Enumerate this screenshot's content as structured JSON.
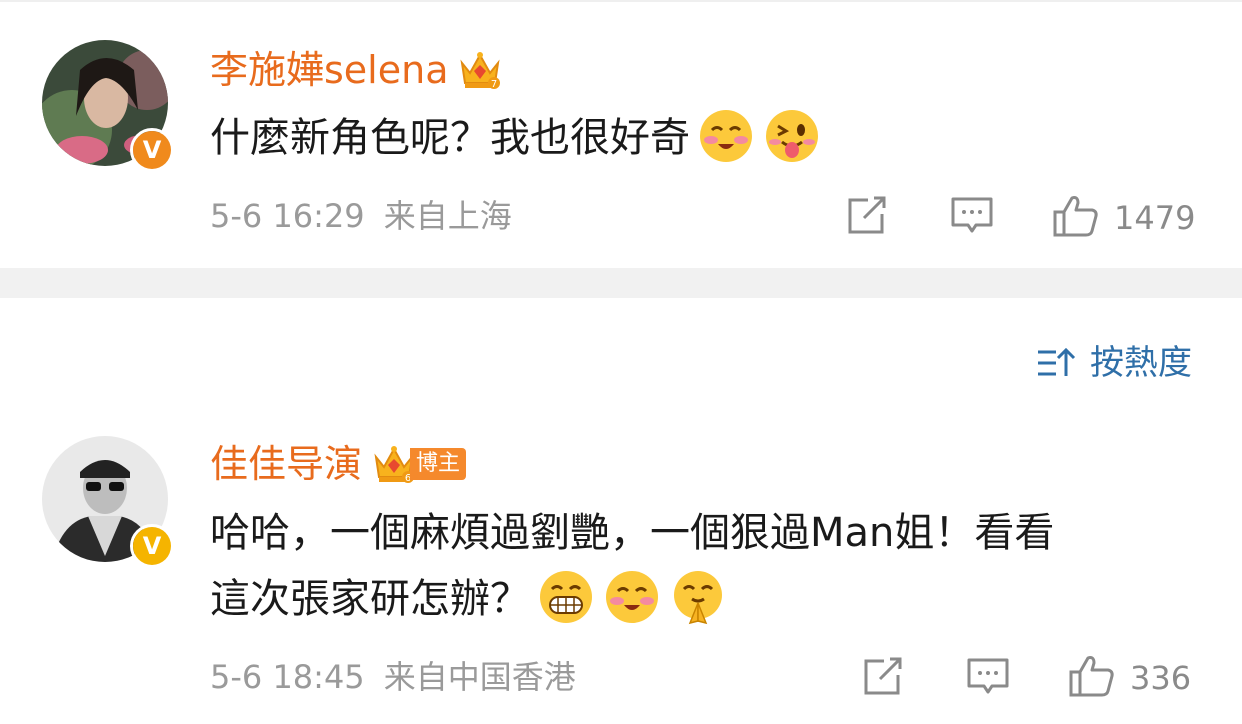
{
  "comments": [
    {
      "username": "李施嬅selena",
      "text": "什麼新角色呢？我也很好奇",
      "time": "5-6 16:29",
      "location": "来自上海",
      "likes": "1479",
      "verified_color": "#f08a1c"
    },
    {
      "username": "佳佳导演",
      "badge": "博主",
      "text_line1": "哈哈，一個麻煩過劉艷，一個狠過Man姐！看看",
      "text_line2": "這次張家研怎辦？",
      "time": "5-6 18:45",
      "location": "来自中国香港",
      "likes": "336",
      "verified_color": "#f5b400"
    }
  ],
  "sort_label": "按熱度",
  "colors": {
    "username": "#e86b1d",
    "link": "#2f6fa8",
    "divider": "#f1f1f1"
  },
  "icons": [
    "crown-icon",
    "share-icon",
    "comment-icon",
    "like-icon",
    "sort-icon",
    "grin-emoji",
    "blush-emoji",
    "tongue-emoji",
    "smile-emoji",
    "fold-hands-emoji"
  ]
}
